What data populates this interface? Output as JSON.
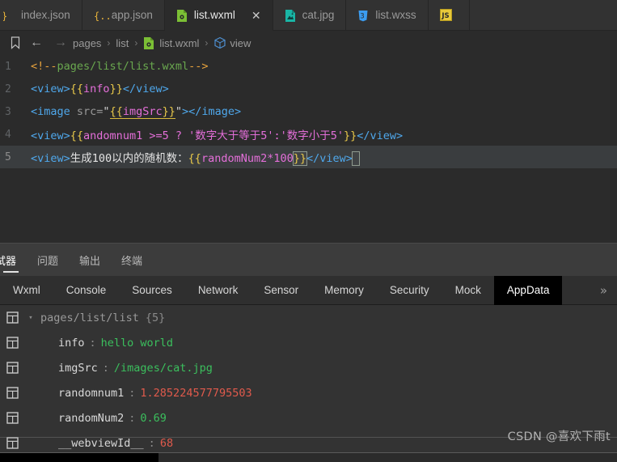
{
  "colors": {
    "editor_bg": "#2b2b2b",
    "tab_bg": "#323232",
    "panel_bg": "#333333",
    "accent_green": "#3bbf5d",
    "accent_red": "#e05a4c",
    "active_tab_bg": "#000000",
    "wxml_icon": "#7bbf35",
    "json_icon": "#e8b33a",
    "image_icon": "#19b5a5",
    "css_icon": "#3b9cf0",
    "js_icon": "#e8c93a"
  },
  "tabbar": {
    "tabs": [
      {
        "label": "index.json",
        "icon": "json-file-icon",
        "active": false,
        "closable": false
      },
      {
        "label": "app.json",
        "icon": "json-file-icon",
        "active": false,
        "closable": false
      },
      {
        "label": "list.wxml",
        "icon": "wxml-file-icon",
        "active": true,
        "closable": true,
        "close_label": "✕"
      },
      {
        "label": "cat.jpg",
        "icon": "image-file-icon",
        "active": false,
        "closable": false
      },
      {
        "label": "list.wxss",
        "icon": "css-file-icon",
        "active": false,
        "closable": false
      },
      {
        "label": "",
        "icon": "js-file-icon",
        "active": false,
        "closable": false
      }
    ]
  },
  "breadcrumb": {
    "bookmark_icon": "bookmark-icon",
    "back_label": "←",
    "forward_label": "→",
    "items": [
      {
        "label": "pages",
        "icon": null
      },
      {
        "label": "list",
        "icon": null
      },
      {
        "label": "list.wxml",
        "icon": "wxml-file-icon"
      },
      {
        "label": "view",
        "icon": "cube-icon"
      }
    ],
    "separator": "›"
  },
  "editor": {
    "lines": [
      {
        "num": "1",
        "active": false
      },
      {
        "num": "2",
        "active": false
      },
      {
        "num": "3",
        "active": false
      },
      {
        "num": "4",
        "active": false
      },
      {
        "num": "5",
        "active": true
      }
    ],
    "code": {
      "l1_open": "<!--",
      "l1_text": "pages/list/list.wxml",
      "l1_close": "-->",
      "l2_open": "<view>",
      "l2_braces_open": "{{",
      "l2_expr": "info",
      "l2_braces_close": "}}",
      "l2_close": "</view>",
      "l3_open": "<image ",
      "l3_attr": "src=",
      "l3_q1": "\"",
      "l3_braces_open": "{{",
      "l3_expr": "imgSrc",
      "l3_braces_close": "}}",
      "l3_q2": "\"",
      "l3_gt": ">",
      "l3_close": "</image>",
      "l4_open": "<view>",
      "l4_braces_open": "{{",
      "l4_expr": "andomnum1 >=5 ? '数字大于等于5':'数字小于5'",
      "l4_braces_close": "}}",
      "l4_close": "</view>",
      "l5_open": "<view>",
      "l5_text": "生成100以内的随机数：",
      "l5_braces_open": "{{",
      "l5_expr": "randomNum2*100",
      "l5_braces_close": "}}",
      "l5_close": "</view>"
    }
  },
  "panel_tabs": {
    "tabs": [
      {
        "label": "试器",
        "active": true
      },
      {
        "label": "问题",
        "active": false
      },
      {
        "label": "输出",
        "active": false
      },
      {
        "label": "终端",
        "active": false
      }
    ]
  },
  "devtools": {
    "tabs": [
      {
        "label": "Wxml",
        "active": false
      },
      {
        "label": "Console",
        "active": false
      },
      {
        "label": "Sources",
        "active": false
      },
      {
        "label": "Network",
        "active": false
      },
      {
        "label": "Sensor",
        "active": false
      },
      {
        "label": "Memory",
        "active": false
      },
      {
        "label": "Security",
        "active": false
      },
      {
        "label": "Mock",
        "active": false
      },
      {
        "label": "AppData",
        "active": true
      }
    ],
    "more_label": "»"
  },
  "appdata": {
    "root": {
      "label": "pages/list/list",
      "count": "{5}",
      "caret": "▾"
    },
    "entries": [
      {
        "key": "info",
        "colon": ":",
        "value": "hello world",
        "value_color": "green"
      },
      {
        "key": "imgSrc",
        "colon": ":",
        "value": "/images/cat.jpg",
        "value_color": "green"
      },
      {
        "key": "randomnum1",
        "colon": ":",
        "value": "1.285224577795503",
        "value_color": "red"
      },
      {
        "key": "randomNum2",
        "colon": ":",
        "value": "0.69",
        "value_color": "green"
      },
      {
        "key": "__webviewId__",
        "colon": ":",
        "value": "68",
        "value_color": "red"
      }
    ]
  },
  "watermark": {
    "text": "CSDN @喜欢下雨t"
  }
}
